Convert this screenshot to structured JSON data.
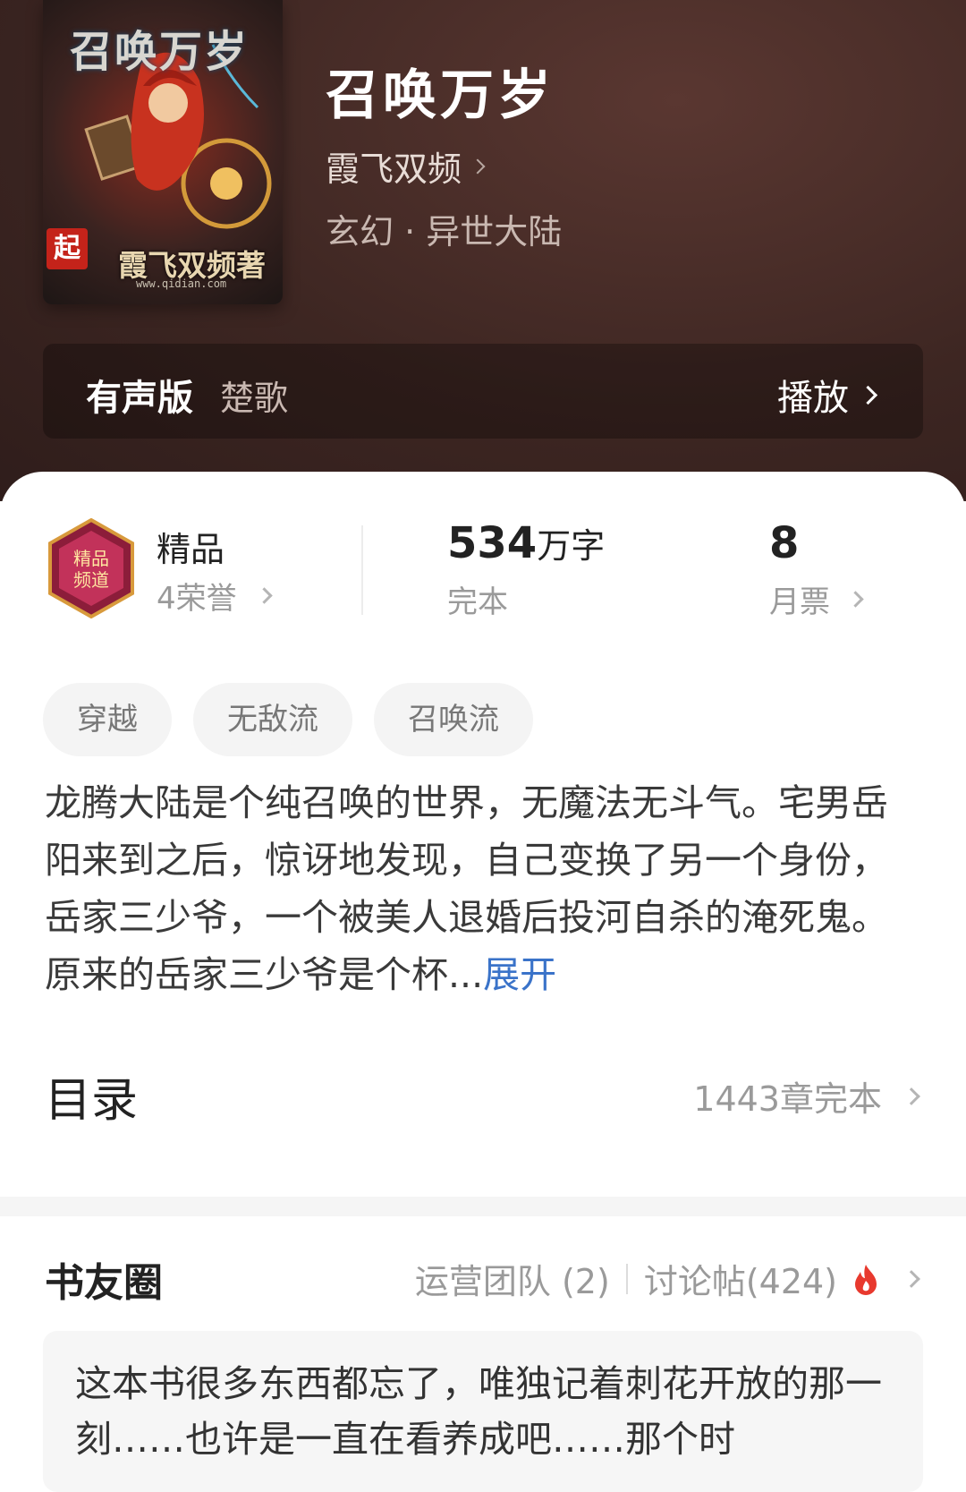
{
  "cover": {
    "title_art": "召唤万岁",
    "author_art": "霞飞双频著",
    "site": "www.qidian.com",
    "badge": "起"
  },
  "book": {
    "title": "召唤万岁",
    "author": "霞飞双频",
    "genre": "玄幻 · 异世大陆"
  },
  "audio": {
    "label": "有声版",
    "narrator": "楚歌",
    "play": "播放"
  },
  "stats": {
    "badge_title": "精品",
    "honors": "4荣誉",
    "word_count": "534",
    "word_unit": "万字",
    "status": "完本",
    "monthly_votes": "8",
    "monthly_votes_label": "月票"
  },
  "tags": [
    "穿越",
    "无敌流",
    "召唤流"
  ],
  "description": {
    "text": "龙腾大陆是个纯召唤的世界，无魔法无斗气。宅男岳阳来到之后，惊讶地发现，自己变换了另一个身份，岳家三少爷，一个被美人退婚后投河自杀的淹死鬼。原来的岳家三少爷是个杯...",
    "expand": "展开"
  },
  "toc": {
    "title": "目录",
    "info": "1443章完本"
  },
  "circle": {
    "title": "书友圈",
    "team": "运营团队 (2)",
    "posts": "讨论帖(424)"
  },
  "post": {
    "text": "这本书很多东西都忘了，唯独记着刺花开放的那一刻……也许是一直在看养成吧……那个时"
  },
  "colors": {
    "hero_bg": "#3d2622",
    "accent_link": "#3a73c9",
    "fire": "#e8392e"
  }
}
